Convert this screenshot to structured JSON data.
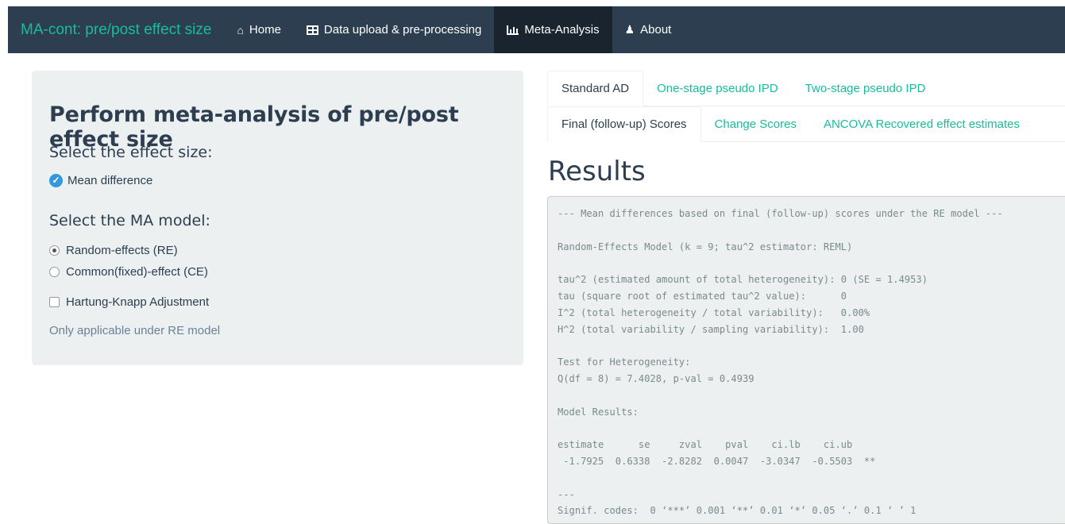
{
  "navbar": {
    "brand": "MA-cont: pre/post effect size",
    "items": [
      {
        "label": "Home",
        "icon": "home-icon",
        "active": false
      },
      {
        "label": "Data upload & pre-processing",
        "icon": "table-icon",
        "active": false
      },
      {
        "label": "Meta-Analysis",
        "icon": "bar-chart-icon",
        "active": true
      },
      {
        "label": "About",
        "icon": "users-icon",
        "active": false
      }
    ]
  },
  "sidebar": {
    "title": "Perform meta-analysis of pre/post effect size",
    "effect_size_label": "Select the effect size:",
    "effect_size_option": "Mean difference",
    "model_label": "Select the MA model:",
    "model_options": [
      "Random-effects (RE)",
      "Common(fixed)-effect (CE)"
    ],
    "model_selected": "Random-effects (RE)",
    "hk_label": "Hartung-Knapp Adjustment",
    "hk_checked": false,
    "hk_help": "Only applicable under RE model"
  },
  "tabs_row1": [
    "Standard AD",
    "One-stage pseudo IPD",
    "Two-stage pseudo IPD"
  ],
  "tabs_row2": [
    "Final (follow-up) Scores",
    "Change Scores",
    "ANCOVA Recovered effect estimates"
  ],
  "results": {
    "title": "Results",
    "output": "--- Mean differences based on final (follow-up) scores under the RE model ---\n\nRandom-Effects Model (k = 9; tau^2 estimator: REML)\n\ntau^2 (estimated amount of total heterogeneity): 0 (SE = 1.4953)\ntau (square root of estimated tau^2 value):      0\nI^2 (total heterogeneity / total variability):   0.00%\nH^2 (total variability / sampling variability):  1.00\n\nTest for Heterogeneity:\nQ(df = 8) = 7.4028, p-val = 0.4939\n\nModel Results:\n\nestimate      se     zval    pval    ci.lb    ci.ub\n -1.7925  0.6338  -2.8282  0.0047  -3.0347  -0.5503  **\n\n---\nSignif. codes:  0 ‘***’ 0.001 ‘**’ 0.01 ‘*’ 0.05 ‘.’ 0.1 ‘ ’ 1"
  },
  "colors": {
    "navbar_bg": "#2c3e50",
    "brand": "#18bc9c",
    "well_bg": "#ecf0f1",
    "tab_link": "#18bc9c",
    "checkbox_accent": "#3498db"
  }
}
